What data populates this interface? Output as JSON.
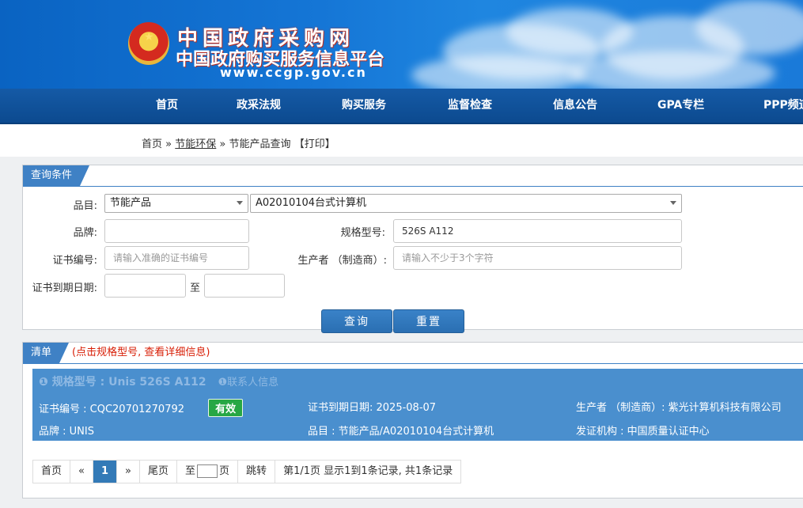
{
  "header": {
    "title_main": "中国政府采购网",
    "title_sub": "中国政府购买服务信息平台",
    "url": "www.ccgp.gov.cn"
  },
  "nav": [
    "首页",
    "政采法规",
    "购买服务",
    "监督检查",
    "信息公告",
    "GPA专栏",
    "PPP频道"
  ],
  "breadcrumb": {
    "home": "首页",
    "sep1": "»",
    "category": "节能环保",
    "sep2": "»",
    "current": "节能产品查询",
    "print": "【打印】"
  },
  "query": {
    "tab": "查询条件",
    "category_label": "品目:",
    "category_value": "节能产品",
    "subcategory_value": "A02010104台式计算机",
    "brand_label": "品牌:",
    "brand_value": "",
    "model_label": "规格型号:",
    "model_value": "526S A112",
    "cert_label": "证书编号:",
    "cert_placeholder": "请输入准确的证书编号",
    "maker_label": "生产者 （制造商）:",
    "maker_placeholder": "请输入不少于3个字符",
    "expiry_label": "证书到期日期:",
    "to_label": "至",
    "search_button": "查询",
    "reset_button": "重置"
  },
  "list": {
    "tab": "清单",
    "hint": "(点击规格型号, 查看详细信息)",
    "items": [
      {
        "model": "❶ 规格型号 : Unis 526S A112",
        "contact": "❶联系人信息",
        "cert_no": "证书编号 : CQC20701270792",
        "status": "有效",
        "expiry": "证书到期日期: 2025-08-07",
        "maker": "生产者 （制造商）: 紫光计算机科技有限公司",
        "brand": "品牌 : UNIS",
        "category": "品目 : 节能产品/A02010104台式计算机",
        "issuer": "发证机构 : 中国质量认证中心"
      }
    ]
  },
  "pagination": {
    "first": "首页",
    "prev": "«",
    "current": "1",
    "next": "»",
    "last": "尾页",
    "goto_prefix": "至",
    "goto_suffix": "页",
    "jump": "跳转",
    "info": "第1/1页  显示1到1条记录, 共1条记录"
  },
  "colors": {
    "header_blue": "#1576d6",
    "nav_blue": "#0c4a8f",
    "panel_blue": "#3f81c5",
    "result_bg": "#4a8fce",
    "valid_green": "#27a744",
    "hint_red": "#d81e06"
  }
}
